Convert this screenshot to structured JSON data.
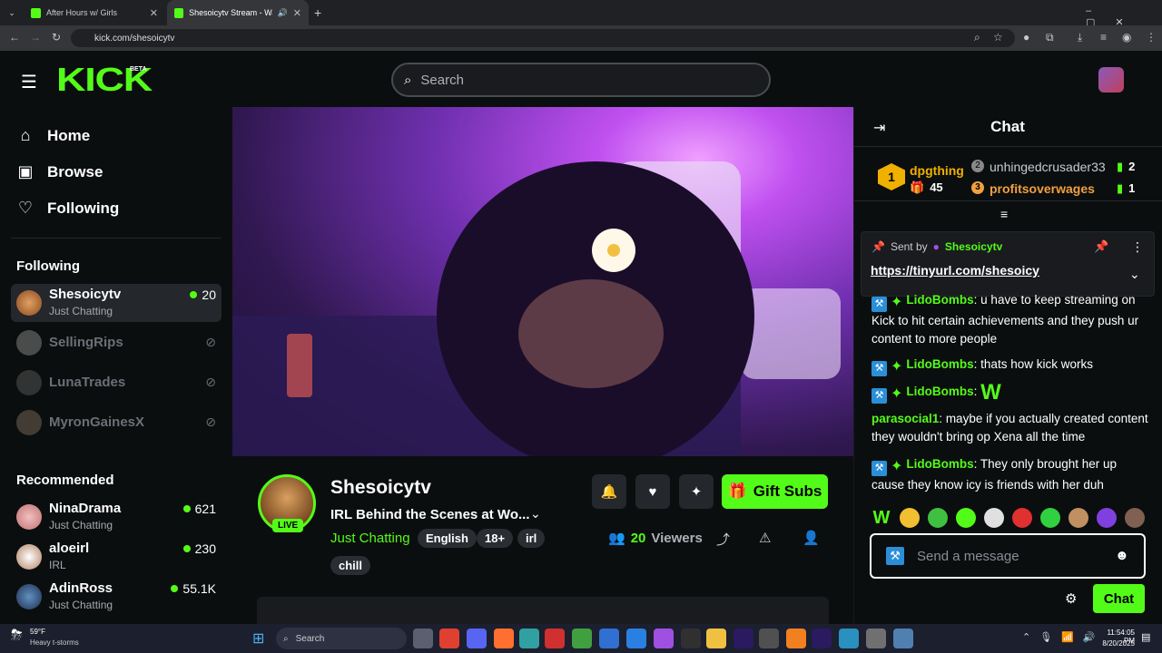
{
  "browser": {
    "tabs": [
      {
        "title": "After Hours w/ Girls"
      },
      {
        "title": "Shesoicytv Stream - Watch"
      }
    ],
    "url": "kick.com/shesoicytv"
  },
  "header": {
    "logo": "KICK",
    "beta": "BETA",
    "search_placeholder": "Search"
  },
  "sidebar": {
    "nav": [
      {
        "label": "Home",
        "icon": "home-icon"
      },
      {
        "label": "Browse",
        "icon": "browse-icon"
      },
      {
        "label": "Following",
        "icon": "heart-icon"
      }
    ],
    "following_title": "Following",
    "following": [
      {
        "name": "Shesoicytv",
        "category": "Just Chatting",
        "viewers": "20",
        "live": true
      },
      {
        "name": "SellingRips",
        "live": false
      },
      {
        "name": "LunaTrades",
        "live": false
      },
      {
        "name": "MyronGainesX",
        "live": false
      }
    ],
    "recommended_title": "Recommended",
    "recommended": [
      {
        "name": "NinaDrama",
        "category": "Just Chatting",
        "viewers": "621"
      },
      {
        "name": "aloeirl",
        "category": "IRL",
        "viewers": "230"
      },
      {
        "name": "AdinRoss",
        "category": "Just Chatting",
        "viewers": "55.1K"
      }
    ]
  },
  "stream": {
    "channel": "Shesoicytv",
    "live_badge": "LIVE",
    "title": "IRL Behind the Scenes at Wo...",
    "category": "Just Chatting",
    "tags": [
      "English",
      "18+",
      "irl",
      "chill"
    ],
    "gift_label": "Gift Subs",
    "viewers_count": "20",
    "viewers_label": "Viewers"
  },
  "chat": {
    "title": "Chat",
    "leaderboard": [
      {
        "rank": "1",
        "name": "dpgthing",
        "count": "45"
      },
      {
        "rank": "2",
        "name": "unhingedcrusader33",
        "count": "2"
      },
      {
        "rank": "3",
        "name": "profitsoverwages",
        "count": "1"
      }
    ],
    "pinned": {
      "sent_by_label": "Sent by",
      "sender": "Shesoicytv",
      "link": "https://tinyurl.com/shesoicy"
    },
    "messages": [
      {
        "user": "LidoBombs",
        "text": "u have to keep streaming on Kick to hit certain achievements and they push ur content to more people"
      },
      {
        "user": "LidoBombs",
        "text": "thats how kick works"
      },
      {
        "user": "LidoBombs",
        "text": "W"
      },
      {
        "user": "parasocial1",
        "text": "maybe if you actually created content they wouldn't bring op Xena all the time"
      },
      {
        "user": "LidoBombs",
        "text": "They only brought her up cause they know icy is friends with her duh"
      }
    ],
    "input_placeholder": "Send a message",
    "send_label": "Chat"
  },
  "taskbar": {
    "weather_temp": "59°F",
    "weather_desc": "Heavy t-storms",
    "search": "Search",
    "time": "11:54:05 PM",
    "date": "8/20/2025"
  }
}
